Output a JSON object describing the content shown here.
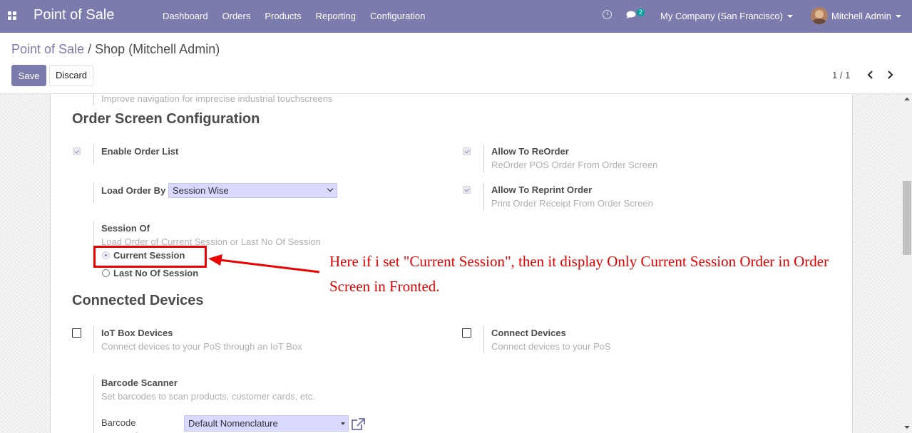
{
  "navbar": {
    "app_title": "Point of Sale",
    "menu": [
      "Dashboard",
      "Orders",
      "Products",
      "Reporting",
      "Configuration"
    ],
    "message_count": "2",
    "company": "My Company (San Francisco)",
    "user": "Mitchell Admin"
  },
  "breadcrumb": {
    "parent": "Point of Sale",
    "separator": "/",
    "current": "Shop (Mitchell Admin)"
  },
  "buttons": {
    "save": "Save",
    "discard": "Discard"
  },
  "pager": {
    "value": "1 / 1"
  },
  "form": {
    "partial_help": "Improve navigation for imprecise industrial touchscreens",
    "order_screen": {
      "title": "Order Screen Configuration",
      "enable_order_list": {
        "label": "Enable Order List",
        "checked": true
      },
      "allow_reorder": {
        "label": "Allow To ReOrder",
        "help": "ReOrder POS Order From Order Screen",
        "checked": true
      },
      "load_order_by": {
        "label": "Load Order By",
        "value": "Session Wise"
      },
      "allow_reprint": {
        "label": "Allow To Reprint Order",
        "help": "Print Order Receipt From Order Screen",
        "checked": true
      },
      "session_of": {
        "label": "Session Of",
        "help": "Load Order of Current Session or Last No Of Session",
        "options": [
          "Current Session",
          "Last No Of Session"
        ],
        "selected": "Current Session"
      }
    },
    "connected_devices": {
      "title": "Connected Devices",
      "iot_box": {
        "label": "IoT Box Devices",
        "help": "Connect devices to your PoS through an IoT Box",
        "checked": false
      },
      "connect_devices": {
        "label": "Connect Devices",
        "help": "Connect devices to your PoS",
        "checked": false
      },
      "barcode_scanner": {
        "label": "Barcode Scanner",
        "help": "Set barcodes to scan products, customer cards, etc."
      },
      "barcode_nomenclature": {
        "label": "Barcode Nomenclature",
        "value": "Default Nomenclature"
      }
    }
  },
  "annotation": {
    "text": "Here if i set \"Current Session\", then it display Only Current Session Order in Order Screen in Fronted.",
    "color": "#e00000"
  },
  "colors": {
    "navbar": "#7c7bad",
    "primary": "#7c7bad",
    "select_bg": "#d9d8ff"
  }
}
